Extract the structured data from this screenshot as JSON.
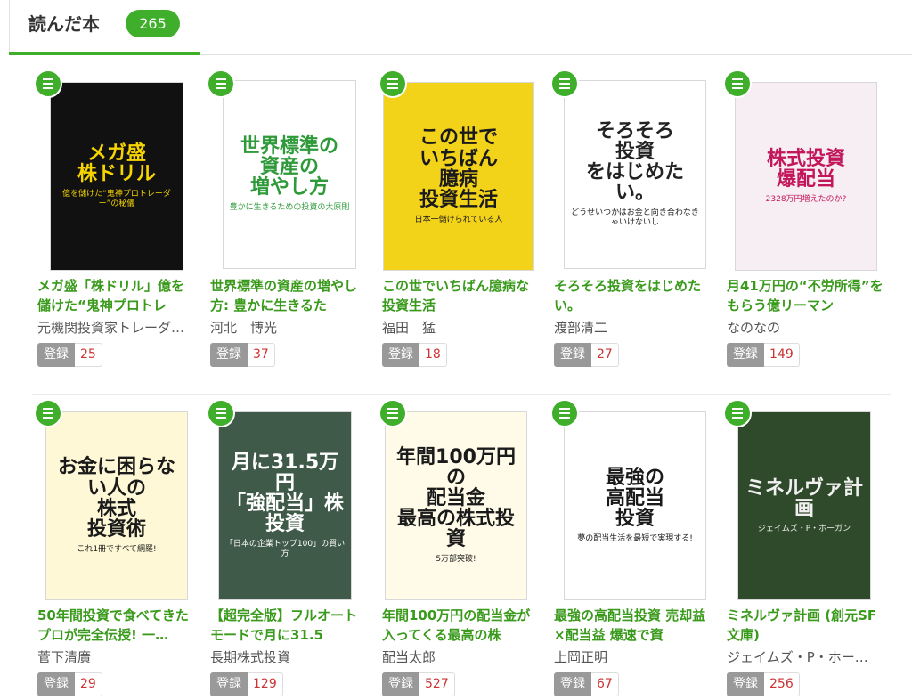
{
  "header": {
    "title": "読んだ本",
    "count": "265"
  },
  "register_label": "登録",
  "books": [
    {
      "title": "メガ盛「株ドリル」億を儲けた“鬼神プロトレ",
      "author": "元機関投資家トレーダ…",
      "count": "25",
      "cover": {
        "main": "メガ盛\n株ドリル",
        "sub": "億を儲けた“鬼神プロトレーダー”の秘儀",
        "bg": "#111111",
        "fg": "#f5d400"
      }
    },
    {
      "title": "世界標準の資産の増やし方: 豊かに生きるた",
      "author": "河北　博光",
      "count": "37",
      "cover": {
        "main": "世界標準の\n資産の\n増やし方",
        "sub": "豊かに生きるための投資の大原則",
        "bg": "#ffffff",
        "fg": "#2e9a3a"
      }
    },
    {
      "title": "この世でいちばん臆病な投資生活",
      "author": "福田　猛",
      "count": "18",
      "cover": {
        "main": "この世で\nいちばん\n臆病\n投資生活",
        "sub": "日本一儲けられている人",
        "bg": "#f3d21a",
        "fg": "#1a1a1a"
      }
    },
    {
      "title": "そろそろ投資をはじめたい。",
      "author": "渡部清二",
      "count": "27",
      "cover": {
        "main": "そろそろ\n投資\nをはじめたい。",
        "sub": "どうせいつかはお金と向き合わなきゃいけないし",
        "bg": "#ffffff",
        "fg": "#222222"
      }
    },
    {
      "title": "月41万円の“不労所得”をもらう億リーマン",
      "author": "なのなの",
      "count": "149",
      "cover": {
        "main": "株式投資\n爆配当",
        "sub": "2328万円増えたのか?",
        "bg": "#f7eef4",
        "fg": "#c2185b"
      }
    },
    {
      "title": "50年間投資で食べてきたプロが完全伝授! 一…",
      "author": "菅下清廣",
      "count": "29",
      "cover": {
        "main": "お金に困らない人の\n株式\n投資術",
        "sub": "これ1冊ですべて網羅!",
        "bg": "#fff8d6",
        "fg": "#1a1a1a"
      }
    },
    {
      "title": "【超完全版】フルオートモードで月に31.5",
      "author": "長期株式投資",
      "count": "129",
      "cover": {
        "main": "月に31.5万円\n「強配当」株投資",
        "sub": "「日本の企業トップ100」の買い方",
        "bg": "#3f5a48",
        "fg": "#ffffff"
      }
    },
    {
      "title": "年間100万円の配当金が入ってくる最高の株",
      "author": "配当太郎",
      "count": "527",
      "cover": {
        "main": "年間100万円の\n配当金\n最高の株式投資",
        "sub": "5万部突破!",
        "bg": "#fffbe8",
        "fg": "#1a1a1a"
      }
    },
    {
      "title": "最強の高配当投資 売却益×配当益 爆速で資",
      "author": "上岡正明",
      "count": "67",
      "cover": {
        "main": "最強の\n高配当\n投資",
        "sub": "夢の配当生活を最短で実現する!",
        "bg": "#ffffff",
        "fg": "#1a1a1a"
      }
    },
    {
      "title": "ミネルヴァ計画 (創元SF文庫)",
      "author": "ジェイムズ・P・ホー…",
      "count": "256",
      "cover": {
        "main": "ミネルヴァ計画",
        "sub": "ジェイムズ・P・ホーガン",
        "bg": "#2f4a2a",
        "fg": "#f0f0f0"
      }
    }
  ]
}
